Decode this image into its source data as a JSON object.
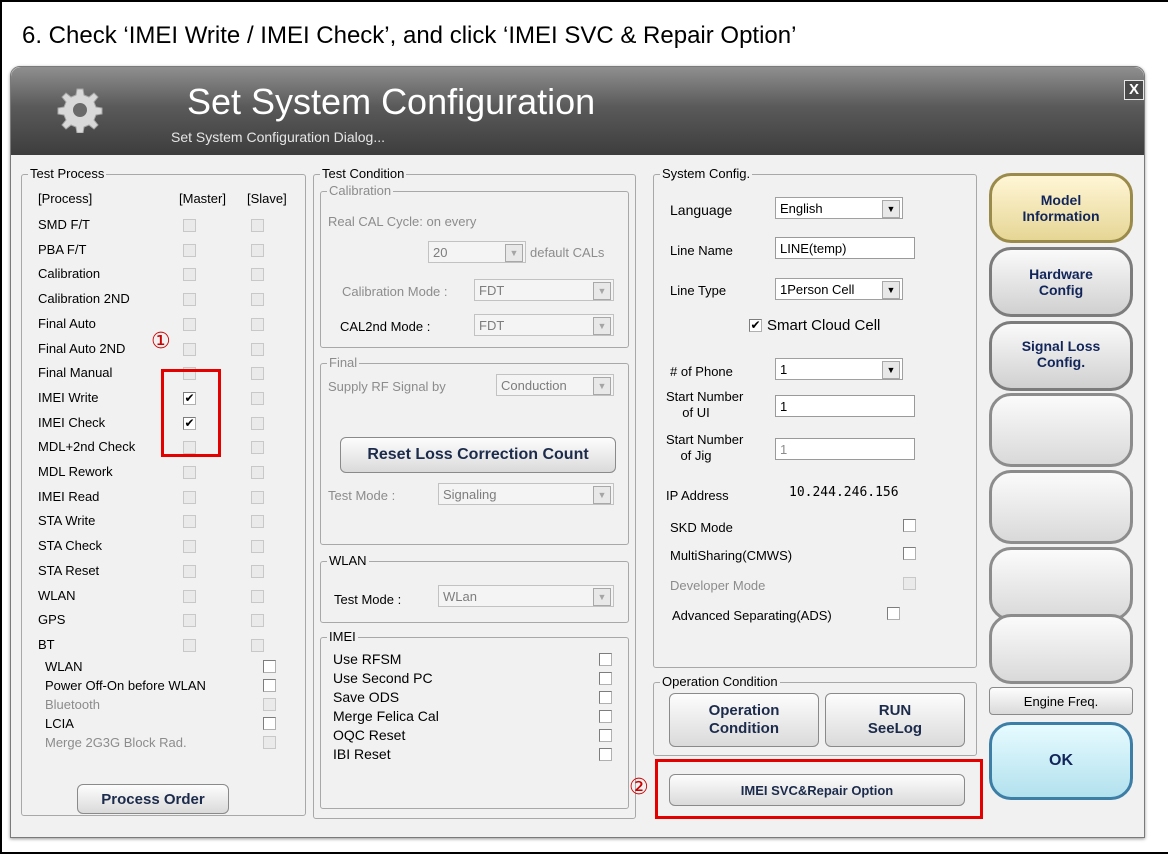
{
  "instruction": "6. Check ‘IMEI Write / IMEI Check’, and click ‘IMEI SVC & Repair Option’",
  "dialog": {
    "title": "Set System Configuration",
    "subtitle": "Set System Configuration Dialog...",
    "close_label": "X"
  },
  "test_process": {
    "label": "Test Process",
    "col_process": "[Process]",
    "col_master": "[Master]",
    "col_slave": "[Slave]",
    "rows": [
      {
        "name": "SMD F/T",
        "master": false,
        "slave": false
      },
      {
        "name": "PBA F/T",
        "master": false,
        "slave": false
      },
      {
        "name": "Calibration",
        "master": false,
        "slave": false
      },
      {
        "name": "Calibration 2ND",
        "master": false,
        "slave": false
      },
      {
        "name": "Final Auto",
        "master": false,
        "slave": false
      },
      {
        "name": "Final Auto 2ND",
        "master": false,
        "slave": false
      },
      {
        "name": "Final Manual",
        "master": false,
        "slave": false
      },
      {
        "name": "IMEI Write",
        "master": true,
        "slave": false
      },
      {
        "name": "IMEI Check",
        "master": true,
        "slave": false
      },
      {
        "name": "MDL+2nd Check",
        "master": false,
        "slave": false
      },
      {
        "name": "MDL Rework",
        "master": false,
        "slave": false
      },
      {
        "name": "IMEI Read",
        "master": false,
        "slave": false
      },
      {
        "name": "STA Write",
        "master": false,
        "slave": false
      },
      {
        "name": "STA Check",
        "master": false,
        "slave": false
      },
      {
        "name": "STA Reset",
        "master": false,
        "slave": false
      },
      {
        "name": "WLAN",
        "master": false,
        "slave": false
      },
      {
        "name": "GPS",
        "master": false,
        "slave": false
      },
      {
        "name": "BT",
        "master": false,
        "slave": false
      }
    ],
    "options": [
      {
        "label": "WLAN",
        "disabled": false
      },
      {
        "label": "Power Off-On before WLAN",
        "disabled": false
      },
      {
        "label": "Bluetooth",
        "disabled": true
      },
      {
        "label": "LCIA",
        "disabled": false
      },
      {
        "label": "Merge 2G3G Block Rad.",
        "disabled": true
      }
    ],
    "process_order_label": "Process Order"
  },
  "test_condition": {
    "label": "Test Condition",
    "calibration": {
      "label": "Calibration",
      "real_cal_cycle": "Real CAL Cycle: on every",
      "cycle_value": "20",
      "default_cals": "default CALs",
      "cal_mode_label": "Calibration Mode :",
      "cal_mode_value": "FDT",
      "cal2nd_label": "CAL2nd Mode :",
      "cal2nd_value": "FDT"
    },
    "final": {
      "label": "Final",
      "supply_label": "Supply RF Signal by",
      "supply_value": "Conduction",
      "reset_button": "Reset Loss Correction Count",
      "test_mode_label": "Test Mode :",
      "test_mode_value": "Signaling"
    },
    "wlan": {
      "label": "WLAN",
      "test_mode_label": "Test Mode :",
      "test_mode_value": "WLan"
    },
    "imei": {
      "label": "IMEI",
      "options": [
        "Use RFSM",
        "Use Second PC",
        "Save ODS",
        "Merge Felica Cal",
        "OQC Reset",
        "IBI Reset"
      ]
    }
  },
  "system_config": {
    "label": "System Config.",
    "language_label": "Language",
    "language_value": "English",
    "line_name_label": "Line Name",
    "line_name_value": "LINE(temp)",
    "line_type_label": "Line Type",
    "line_type_value": "1Person Cell",
    "smart_cloud_label": "Smart Cloud Cell",
    "phone_label": "# of Phone",
    "phone_value": "1",
    "start_ui_label_1": "Start Number",
    "start_ui_label_2": "of UI",
    "start_ui_value": "1",
    "start_jig_label_1": "Start Number",
    "start_jig_label_2": "of Jig",
    "start_jig_value": "1",
    "ip_label": "IP Address",
    "ip_value": "10.244.246.156",
    "options": [
      {
        "label": "SKD Mode",
        "disabled": false
      },
      {
        "label": "MultiSharing(CMWS)",
        "disabled": false
      },
      {
        "label": "Developer Mode",
        "disabled": true
      },
      {
        "label": "Advanced Separating(ADS)",
        "disabled": false
      }
    ]
  },
  "operation_condition": {
    "label": "Operation Condition",
    "op_button_1": "Operation",
    "op_button_2": "Condition",
    "run_button_1": "RUN",
    "run_button_2": "SeeLog",
    "imei_svc_button": "IMEI SVC&Repair Option"
  },
  "side_buttons": {
    "model_1": "Model",
    "model_2": "Information",
    "hardware_1": "Hardware",
    "hardware_2": "Config",
    "signal_1": "Signal Loss",
    "signal_2": "Config.",
    "engine_freq": "Engine Freq.",
    "ok": "OK"
  },
  "markers": {
    "step1": "①",
    "step2": "②"
  },
  "colors": {
    "highlight": "#e50000",
    "title_bar": "#4a4a4a",
    "button_text": "#12255a"
  }
}
